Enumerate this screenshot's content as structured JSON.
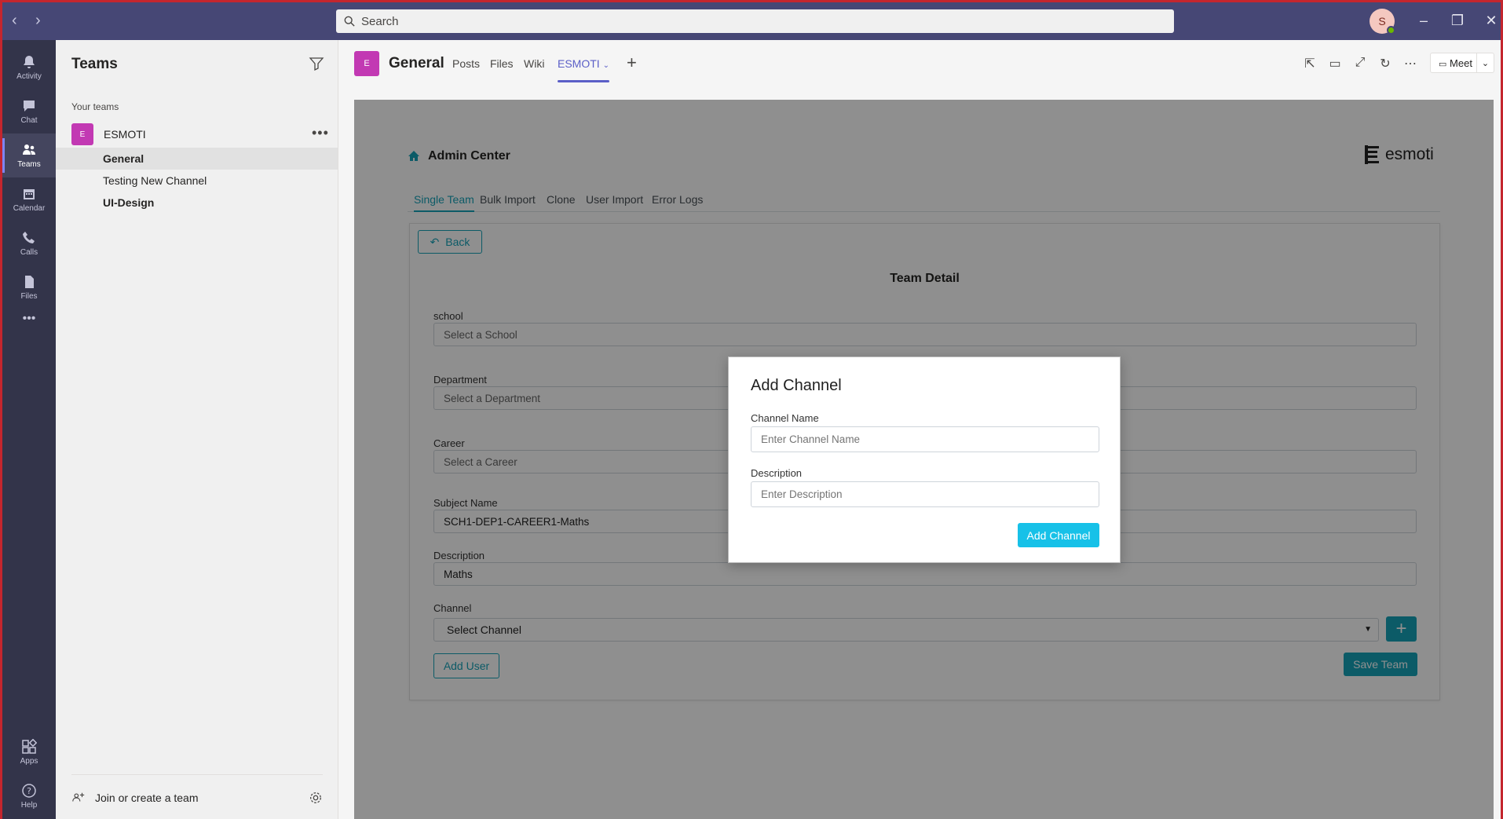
{
  "titlebar": {
    "search_placeholder": "Search",
    "avatar_initial": "S",
    "minimize": "–",
    "restore": "❐",
    "close": "✕"
  },
  "rail": {
    "items": [
      {
        "label": "Activity",
        "icon": "bell-icon"
      },
      {
        "label": "Chat",
        "icon": "chat-icon"
      },
      {
        "label": "Teams",
        "icon": "teams-icon"
      },
      {
        "label": "Calendar",
        "icon": "calendar-icon"
      },
      {
        "label": "Calls",
        "icon": "phone-icon"
      },
      {
        "label": "Files",
        "icon": "file-icon"
      },
      {
        "label": "Apps",
        "icon": "apps-icon"
      },
      {
        "label": "Help",
        "icon": "help-icon"
      }
    ],
    "more": "•••",
    "active": "Teams"
  },
  "teams_panel": {
    "title": "Teams",
    "section_label": "Your teams",
    "team": {
      "initial": "E",
      "name": "ESMOTI",
      "more": "•••"
    },
    "channels": [
      {
        "label": "General",
        "state": "active"
      },
      {
        "label": "Testing New Channel",
        "state": "normal"
      },
      {
        "label": "UI-Design",
        "state": "bold"
      }
    ],
    "join_label": "Join or create a team"
  },
  "channel_header": {
    "initial": "E",
    "title": "General",
    "tabs": [
      "Posts",
      "Files",
      "Wiki",
      "ESMOTI"
    ],
    "active_tab": "ESMOTI",
    "add_tab": "+",
    "meet_label": "Meet"
  },
  "app": {
    "title": "Admin Center",
    "logo_text": "esmoti",
    "tabs": [
      "Single Team",
      "Bulk Import",
      "Clone",
      "User Import",
      "Error Logs"
    ],
    "active_tab": "Single Team",
    "back_label": "Back",
    "card_title": "Team Detail",
    "fields": [
      {
        "label": "school",
        "value": "Select a School",
        "filled": false
      },
      {
        "label": "Department",
        "value": "Select a Department",
        "filled": false
      },
      {
        "label": "Career",
        "value": "Select a Career",
        "filled": false
      },
      {
        "label": "Subject Name",
        "value": "SCH1-DEP1-CAREER1-Maths",
        "filled": true
      },
      {
        "label": "Description",
        "value": "Maths",
        "filled": true
      }
    ],
    "channel_label": "Channel",
    "channel_select": "Select Channel",
    "plus_label": "+",
    "add_user_label": "Add User",
    "save_team_label": "Save Team",
    "accent_color": "#17a2b8"
  },
  "modal": {
    "title": "Add Channel",
    "name_label": "Channel Name",
    "name_placeholder": "Enter Channel Name",
    "desc_label": "Description",
    "desc_placeholder": "Enter Description",
    "submit_label": "Add Channel"
  }
}
